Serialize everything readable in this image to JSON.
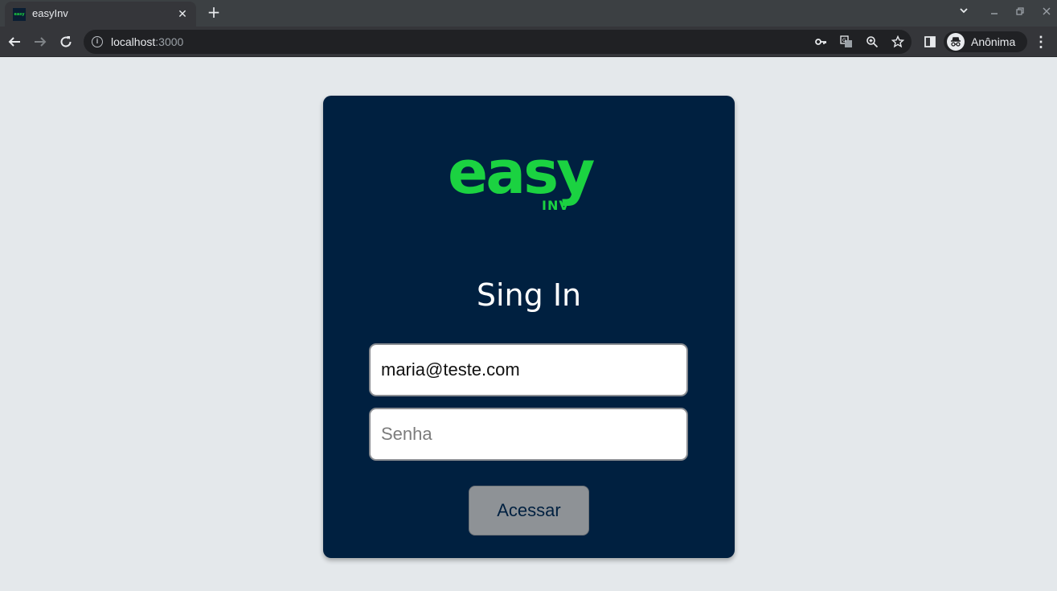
{
  "browser": {
    "tab": {
      "favicon_text": "easy",
      "title": "easyInv",
      "close": "✕"
    },
    "new_tab": "+",
    "url": {
      "host": "localhost",
      "port": ":3000"
    },
    "profile": {
      "name": "Anônima"
    }
  },
  "colors": {
    "brand_green": "#1bd241",
    "card_navy": "#002040",
    "page_background": "#e4e8eb",
    "button_gray": "#8e9296"
  },
  "login": {
    "logo": {
      "word": "easy",
      "sub": "INV"
    },
    "title": "Sing In",
    "email": {
      "value": "maria@teste.com"
    },
    "password": {
      "placeholder": "Senha",
      "value": ""
    },
    "submit_label": "Acessar"
  }
}
